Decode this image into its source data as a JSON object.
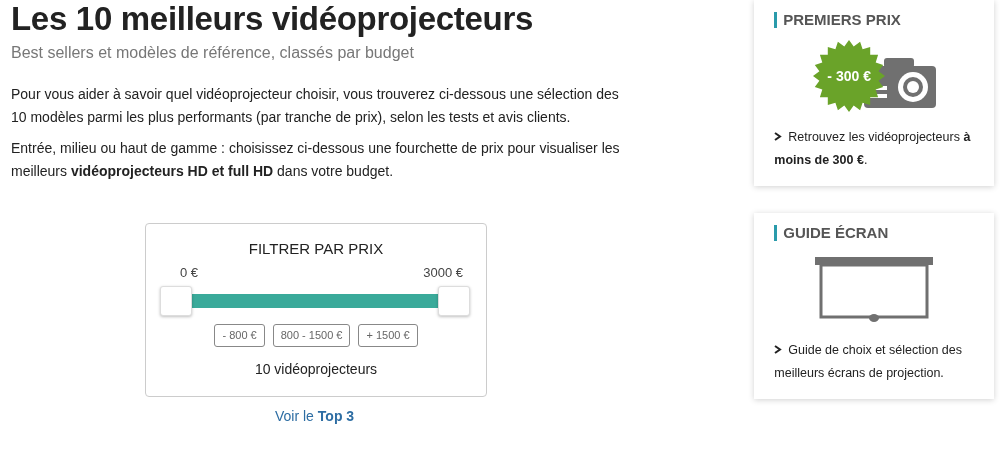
{
  "title": "Les 10 meilleurs vidéoprojecteurs",
  "subtitle": "Best sellers et modèles de référence, classés par budget",
  "paragraphs": [
    "Pour vous aider à savoir quel vidéoprojecteur choisir, vous trouverez ci-dessous une sélection des 10 modèles parmi les plus performants (par tranche de prix), selon les tests et avis clients.",
    "Entrée, milieu ou haut de gamme : choisissez ci-dessous une fourchette de prix pour visualiser les meilleurs **vidéoprojecteurs HD et full HD** dans votre budget."
  ],
  "filter": {
    "title": "FILTRER PAR PRIX",
    "min_label": "0 €",
    "max_label": "3000 €",
    "handles": [
      {
        "level": 0
      },
      {
        "level": 1
      }
    ],
    "buttons": [
      "- 800 €",
      "800 - 1500 €",
      "+ 1500 €"
    ],
    "count": "10 vidéoprojecteurs"
  },
  "top_link": "Voir le **Top 3**",
  "sidebar": [
    {
      "kind": "price",
      "title": "PREMIERS PRIX",
      "badge": "- 300 €",
      "text": "Retrouvez les vidéoprojecteurs **à moins de 300 €**."
    },
    {
      "kind": "screen",
      "title": "GUIDE ÉCRAN",
      "text": "Guide de choix et sélection des meilleurs écrans de projection."
    }
  ]
}
